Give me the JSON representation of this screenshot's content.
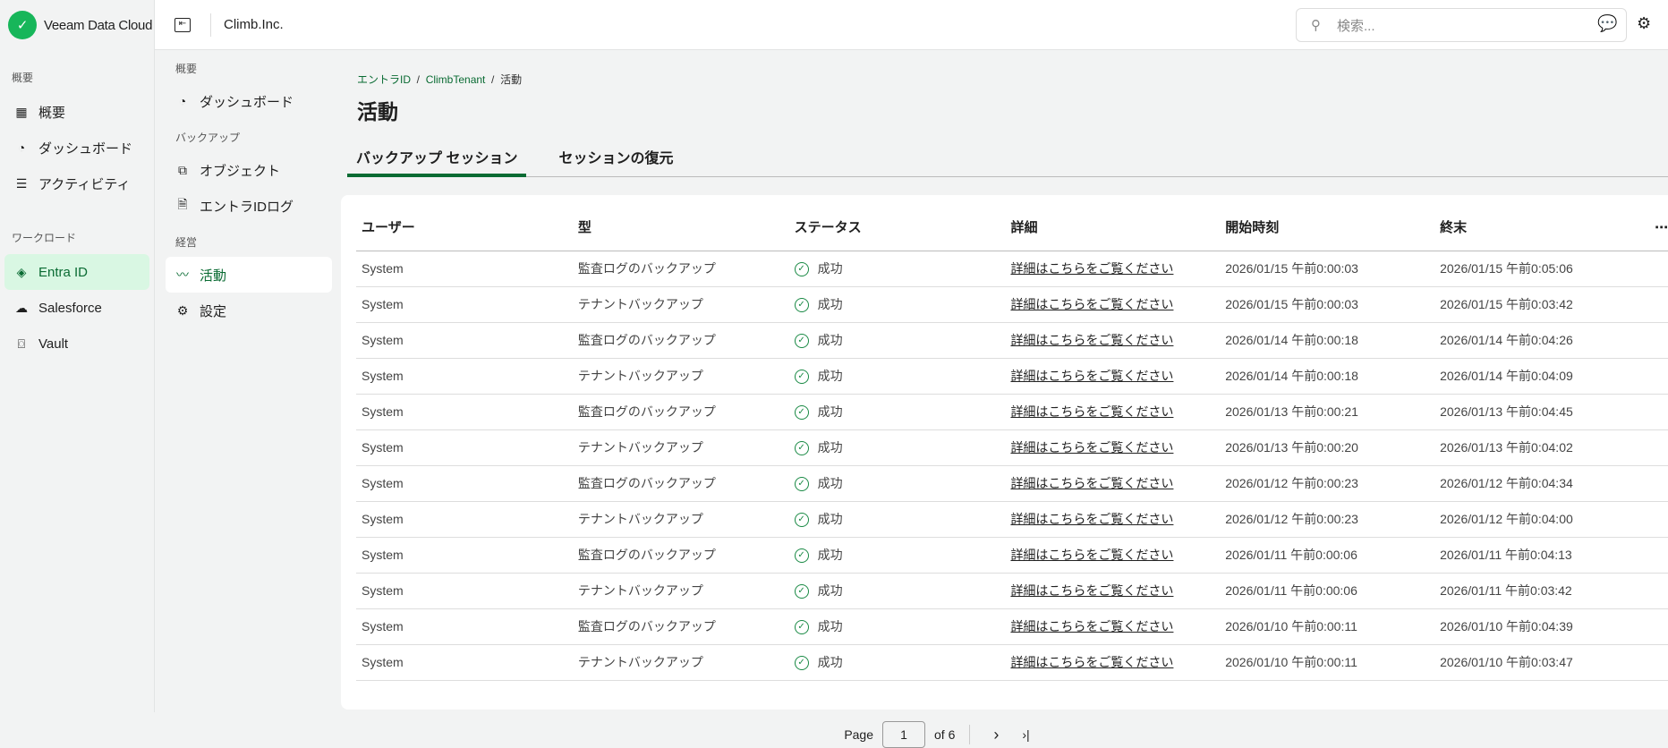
{
  "app": {
    "name": "Veeam Data Cloud",
    "org": "Climb.Inc.",
    "search_placeholder": "検索..."
  },
  "sidebar": {
    "sections": [
      {
        "label": "概要",
        "items": [
          "概要",
          "ダッシュボード",
          "アクティビティ"
        ]
      },
      {
        "label": "ワークロード",
        "items": [
          "Entra ID",
          "Salesforce",
          "Vault"
        ]
      }
    ]
  },
  "subnav": {
    "sections": [
      {
        "label": "概要",
        "items": [
          "ダッシュボード"
        ]
      },
      {
        "label": "バックアップ",
        "items": [
          "オブジェクト",
          "エントラIDログ"
        ]
      },
      {
        "label": "経営",
        "items": [
          "活動",
          "設定"
        ]
      }
    ]
  },
  "breadcrumb": [
    "エントラID",
    "ClimbTenant",
    "活動"
  ],
  "page_title": "活動",
  "tabs": [
    "バックアップ セッション",
    "セッションの復元"
  ],
  "table": {
    "headers": [
      "ユーザー",
      "型",
      "ステータス",
      "詳細",
      "開始時刻",
      "終末",
      "⋯"
    ],
    "rows": [
      [
        "System",
        "監査ログのバックアップ",
        "成功",
        "詳細はこちらをご覧ください",
        "2026/01/15 午前0:00:03",
        "2026/01/15 午前0:05:06"
      ],
      [
        "System",
        "テナントバックアップ",
        "成功",
        "詳細はこちらをご覧ください",
        "2026/01/15 午前0:00:03",
        "2026/01/15 午前0:03:42"
      ],
      [
        "System",
        "監査ログのバックアップ",
        "成功",
        "詳細はこちらをご覧ください",
        "2026/01/14 午前0:00:18",
        "2026/01/14 午前0:04:26"
      ],
      [
        "System",
        "テナントバックアップ",
        "成功",
        "詳細はこちらをご覧ください",
        "2026/01/14 午前0:00:18",
        "2026/01/14 午前0:04:09"
      ],
      [
        "System",
        "監査ログのバックアップ",
        "成功",
        "詳細はこちらをご覧ください",
        "2026/01/13 午前0:00:21",
        "2026/01/13 午前0:04:45"
      ],
      [
        "System",
        "テナントバックアップ",
        "成功",
        "詳細はこちらをご覧ください",
        "2026/01/13 午前0:00:20",
        "2026/01/13 午前0:04:02"
      ],
      [
        "System",
        "監査ログのバックアップ",
        "成功",
        "詳細はこちらをご覧ください",
        "2026/01/12 午前0:00:23",
        "2026/01/12 午前0:04:34"
      ],
      [
        "System",
        "テナントバックアップ",
        "成功",
        "詳細はこちらをご覧ください",
        "2026/01/12 午前0:00:23",
        "2026/01/12 午前0:04:00"
      ],
      [
        "System",
        "監査ログのバックアップ",
        "成功",
        "詳細はこちらをご覧ください",
        "2026/01/11 午前0:00:06",
        "2026/01/11 午前0:04:13"
      ],
      [
        "System",
        "テナントバックアップ",
        "成功",
        "詳細はこちらをご覧ください",
        "2026/01/11 午前0:00:06",
        "2026/01/11 午前0:03:42"
      ],
      [
        "System",
        "監査ログのバックアップ",
        "成功",
        "詳細はこちらをご覧ください",
        "2026/01/10 午前0:00:11",
        "2026/01/10 午前0:04:39"
      ],
      [
        "System",
        "テナントバックアップ",
        "成功",
        "詳細はこちらをご覧ください",
        "2026/01/10 午前0:00:11",
        "2026/01/10 午前0:03:47"
      ]
    ]
  },
  "pager": {
    "label": "Page",
    "current": "1",
    "of": "of 6"
  }
}
